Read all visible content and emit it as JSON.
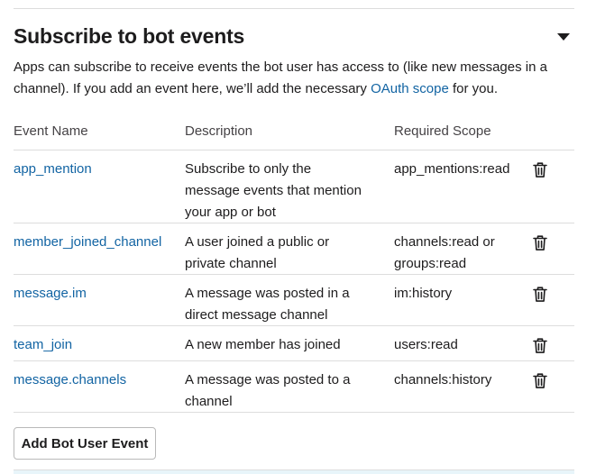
{
  "section": {
    "title": "Subscribe to bot events",
    "description_before_link": "Apps can subscribe to receive events the bot user has access to (like new messages in a channel). If you add an event here, we’ll add the necessary ",
    "link_text": "OAuth scope",
    "description_after_link": " for you."
  },
  "table": {
    "headers": {
      "event_name": "Event Name",
      "description": "Description",
      "required_scope": "Required Scope"
    },
    "rows": [
      {
        "event": "app_mention",
        "description": "Subscribe to only the message events that mention your app or bot",
        "scope": "app_mentions:read"
      },
      {
        "event": "member_joined_channel",
        "description": "A user joined a public or private channel",
        "scope": "channels:read or groups:read"
      },
      {
        "event": "message.im",
        "description": "A message was posted in a direct message channel",
        "scope": "im:history"
      },
      {
        "event": "team_join",
        "description": "A new member has joined",
        "scope": "users:read"
      },
      {
        "event": "message.channels",
        "description": "A message was posted to a channel",
        "scope": "channels:history"
      }
    ]
  },
  "actions": {
    "add_event_label": "Add Bot User Event"
  },
  "icons": {
    "collapse": "caret-down-icon",
    "delete": "trash-icon"
  },
  "colors": {
    "text": "#1d1c1d",
    "link": "#1264a3",
    "divider": "#dddddd",
    "header_text": "#454245"
  }
}
